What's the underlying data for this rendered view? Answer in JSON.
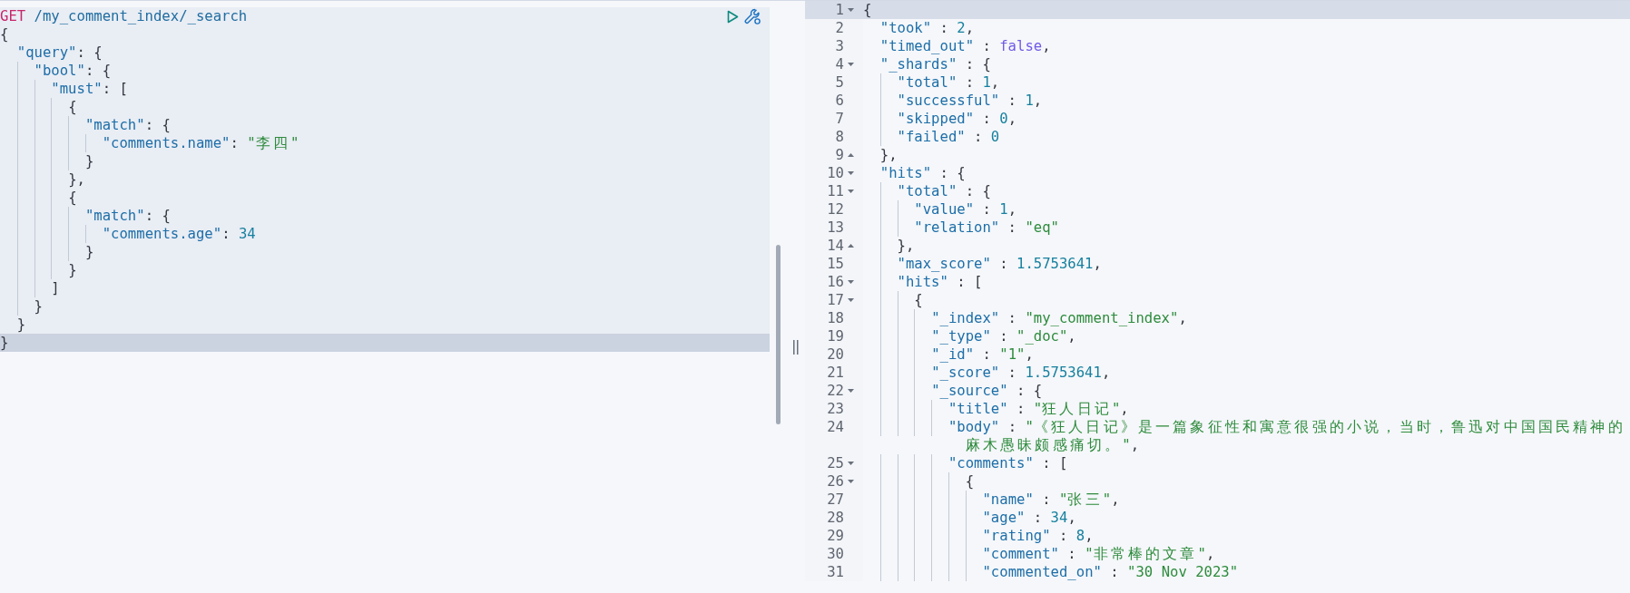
{
  "request_editor": {
    "request": {
      "method": "GET",
      "path": "/my_comment_index/_search"
    },
    "lines": [
      {
        "active": false,
        "tokens": [
          {
            "kind": "punct",
            "text": "{"
          }
        ]
      },
      {
        "active": false,
        "tokens": [
          {
            "kind": "key",
            "text": "  \"query\""
          },
          {
            "kind": "punct",
            "text": ": {"
          }
        ]
      },
      {
        "active": false,
        "tokens": [
          {
            "kind": "key",
            "text": "    \"bool\""
          },
          {
            "kind": "punct",
            "text": ": {"
          }
        ]
      },
      {
        "active": false,
        "tokens": [
          {
            "kind": "key",
            "text": "      \"must\""
          },
          {
            "kind": "punct",
            "text": ": ["
          }
        ]
      },
      {
        "active": false,
        "tokens": [
          {
            "kind": "punct",
            "text": "        {"
          }
        ]
      },
      {
        "active": false,
        "tokens": [
          {
            "kind": "key",
            "text": "          \"match\""
          },
          {
            "kind": "punct",
            "text": ": {"
          }
        ]
      },
      {
        "active": false,
        "tokens": [
          {
            "kind": "key",
            "text": "            \"comments.name\""
          },
          {
            "kind": "punct",
            "text": ": "
          },
          {
            "kind": "string",
            "text": "\"李四\""
          }
        ]
      },
      {
        "active": false,
        "tokens": [
          {
            "kind": "punct",
            "text": "          }"
          }
        ]
      },
      {
        "active": false,
        "tokens": [
          {
            "kind": "punct",
            "text": "        },"
          }
        ]
      },
      {
        "active": false,
        "tokens": [
          {
            "kind": "punct",
            "text": "        {"
          }
        ]
      },
      {
        "active": false,
        "tokens": [
          {
            "kind": "key",
            "text": "          \"match\""
          },
          {
            "kind": "punct",
            "text": ": {"
          }
        ]
      },
      {
        "active": false,
        "tokens": [
          {
            "kind": "key",
            "text": "            \"comments.age\""
          },
          {
            "kind": "punct",
            "text": ": "
          },
          {
            "kind": "number",
            "text": "34"
          }
        ]
      },
      {
        "active": false,
        "tokens": [
          {
            "kind": "punct",
            "text": "          }"
          }
        ]
      },
      {
        "active": false,
        "tokens": [
          {
            "kind": "punct",
            "text": "        }"
          }
        ]
      },
      {
        "active": false,
        "tokens": [
          {
            "kind": "punct",
            "text": "      ]"
          }
        ]
      },
      {
        "active": false,
        "tokens": [
          {
            "kind": "punct",
            "text": "    }"
          }
        ]
      },
      {
        "active": false,
        "tokens": [
          {
            "kind": "punct",
            "text": "  }"
          }
        ]
      },
      {
        "active": true,
        "tokens": [
          {
            "kind": "punct",
            "text": "}"
          }
        ]
      }
    ]
  },
  "response_viewer": {
    "lines": [
      {
        "number": "1",
        "kind": "fold_start",
        "active": true,
        "tokens": [
          {
            "kind": "punct",
            "text": "{"
          }
        ]
      },
      {
        "number": "2",
        "active": false,
        "tokens": [
          {
            "kind": "key",
            "text": "  \"took\""
          },
          {
            "kind": "punct",
            "text": " : "
          },
          {
            "kind": "number",
            "text": "2"
          },
          {
            "kind": "punct",
            "text": ","
          }
        ]
      },
      {
        "number": "3",
        "active": false,
        "tokens": [
          {
            "kind": "key",
            "text": "  \"timed_out\""
          },
          {
            "kind": "punct",
            "text": " : "
          },
          {
            "kind": "boolean",
            "text": "false"
          },
          {
            "kind": "punct",
            "text": ","
          }
        ]
      },
      {
        "number": "4",
        "kind": "fold_start",
        "active": false,
        "tokens": [
          {
            "kind": "key",
            "text": "  \"_shards\""
          },
          {
            "kind": "punct",
            "text": " : {"
          }
        ]
      },
      {
        "number": "5",
        "active": false,
        "tokens": [
          {
            "kind": "key",
            "text": "    \"total\""
          },
          {
            "kind": "punct",
            "text": " : "
          },
          {
            "kind": "number",
            "text": "1"
          },
          {
            "kind": "punct",
            "text": ","
          }
        ]
      },
      {
        "number": "6",
        "active": false,
        "tokens": [
          {
            "kind": "key",
            "text": "    \"successful\""
          },
          {
            "kind": "punct",
            "text": " : "
          },
          {
            "kind": "number",
            "text": "1"
          },
          {
            "kind": "punct",
            "text": ","
          }
        ]
      },
      {
        "number": "7",
        "active": false,
        "tokens": [
          {
            "kind": "key",
            "text": "    \"skipped\""
          },
          {
            "kind": "punct",
            "text": " : "
          },
          {
            "kind": "number",
            "text": "0"
          },
          {
            "kind": "punct",
            "text": ","
          }
        ]
      },
      {
        "number": "8",
        "active": false,
        "tokens": [
          {
            "kind": "key",
            "text": "    \"failed\""
          },
          {
            "kind": "punct",
            "text": " : "
          },
          {
            "kind": "number",
            "text": "0"
          }
        ]
      },
      {
        "number": "9",
        "kind": "fold_end",
        "active": false,
        "tokens": [
          {
            "kind": "punct",
            "text": "  },"
          }
        ]
      },
      {
        "number": "10",
        "kind": "fold_start",
        "active": false,
        "tokens": [
          {
            "kind": "key",
            "text": "  \"hits\""
          },
          {
            "kind": "punct",
            "text": " : {"
          }
        ]
      },
      {
        "number": "11",
        "kind": "fold_start",
        "active": false,
        "tokens": [
          {
            "kind": "key",
            "text": "    \"total\""
          },
          {
            "kind": "punct",
            "text": " : {"
          }
        ]
      },
      {
        "number": "12",
        "active": false,
        "tokens": [
          {
            "kind": "key",
            "text": "      \"value\""
          },
          {
            "kind": "punct",
            "text": " : "
          },
          {
            "kind": "number",
            "text": "1"
          },
          {
            "kind": "punct",
            "text": ","
          }
        ]
      },
      {
        "number": "13",
        "active": false,
        "tokens": [
          {
            "kind": "key",
            "text": "      \"relation\""
          },
          {
            "kind": "punct",
            "text": " : "
          },
          {
            "kind": "string",
            "text": "\"eq\""
          }
        ]
      },
      {
        "number": "14",
        "kind": "fold_end",
        "active": false,
        "tokens": [
          {
            "kind": "punct",
            "text": "    },"
          }
        ]
      },
      {
        "number": "15",
        "active": false,
        "tokens": [
          {
            "kind": "key",
            "text": "    \"max_score\""
          },
          {
            "kind": "punct",
            "text": " : "
          },
          {
            "kind": "number",
            "text": "1.5753641"
          },
          {
            "kind": "punct",
            "text": ","
          }
        ]
      },
      {
        "number": "16",
        "kind": "fold_start",
        "active": false,
        "tokens": [
          {
            "kind": "key",
            "text": "    \"hits\""
          },
          {
            "kind": "punct",
            "text": " : ["
          }
        ]
      },
      {
        "number": "17",
        "kind": "fold_start",
        "active": false,
        "tokens": [
          {
            "kind": "punct",
            "text": "      {"
          }
        ]
      },
      {
        "number": "18",
        "active": false,
        "tokens": [
          {
            "kind": "key",
            "text": "        \"_index\""
          },
          {
            "kind": "punct",
            "text": " : "
          },
          {
            "kind": "string",
            "text": "\"my_comment_index\""
          },
          {
            "kind": "punct",
            "text": ","
          }
        ]
      },
      {
        "number": "19",
        "active": false,
        "tokens": [
          {
            "kind": "key",
            "text": "        \"_type\""
          },
          {
            "kind": "punct",
            "text": " : "
          },
          {
            "kind": "string",
            "text": "\"_doc\""
          },
          {
            "kind": "punct",
            "text": ","
          }
        ]
      },
      {
        "number": "20",
        "active": false,
        "tokens": [
          {
            "kind": "key",
            "text": "        \"_id\""
          },
          {
            "kind": "punct",
            "text": " : "
          },
          {
            "kind": "string",
            "text": "\"1\""
          },
          {
            "kind": "punct",
            "text": ","
          }
        ]
      },
      {
        "number": "21",
        "active": false,
        "tokens": [
          {
            "kind": "key",
            "text": "        \"_score\""
          },
          {
            "kind": "punct",
            "text": " : "
          },
          {
            "kind": "number",
            "text": "1.5753641"
          },
          {
            "kind": "punct",
            "text": ","
          }
        ]
      },
      {
        "number": "22",
        "kind": "fold_start",
        "active": false,
        "tokens": [
          {
            "kind": "key",
            "text": "        \"_source\""
          },
          {
            "kind": "punct",
            "text": " : {"
          }
        ]
      },
      {
        "number": "23",
        "active": false,
        "tokens": [
          {
            "kind": "key",
            "text": "          \"title\""
          },
          {
            "kind": "punct",
            "text": " : "
          },
          {
            "kind": "string",
            "text": "\"狂人日记\""
          },
          {
            "kind": "punct",
            "text": ","
          }
        ]
      },
      {
        "number": "24",
        "active": false,
        "tokens": [
          {
            "kind": "key",
            "text": "          \"body\""
          },
          {
            "kind": "punct",
            "text": " : "
          },
          {
            "kind": "string",
            "text": "\"《狂人日记》是一篇象征性和寓意很强的小说，当时，鲁迅对中国国民精神的麻木愚昧颇感痛切。\""
          },
          {
            "kind": "punct",
            "text": ","
          }
        ]
      },
      {
        "number": "25",
        "kind": "fold_start",
        "active": false,
        "tokens": [
          {
            "kind": "key",
            "text": "          \"comments\""
          },
          {
            "kind": "punct",
            "text": " : ["
          }
        ]
      },
      {
        "number": "26",
        "kind": "fold_start",
        "active": false,
        "tokens": [
          {
            "kind": "punct",
            "text": "            {"
          }
        ]
      },
      {
        "number": "27",
        "active": false,
        "tokens": [
          {
            "kind": "key",
            "text": "              \"name\""
          },
          {
            "kind": "punct",
            "text": " : "
          },
          {
            "kind": "string",
            "text": "\"张三\""
          },
          {
            "kind": "punct",
            "text": ","
          }
        ]
      },
      {
        "number": "28",
        "active": false,
        "tokens": [
          {
            "kind": "key",
            "text": "              \"age\""
          },
          {
            "kind": "punct",
            "text": " : "
          },
          {
            "kind": "number",
            "text": "34"
          },
          {
            "kind": "punct",
            "text": ","
          }
        ]
      },
      {
        "number": "29",
        "active": false,
        "tokens": [
          {
            "kind": "key",
            "text": "              \"rating\""
          },
          {
            "kind": "punct",
            "text": " : "
          },
          {
            "kind": "number",
            "text": "8"
          },
          {
            "kind": "punct",
            "text": ","
          }
        ]
      },
      {
        "number": "30",
        "active": false,
        "tokens": [
          {
            "kind": "key",
            "text": "              \"comment\""
          },
          {
            "kind": "punct",
            "text": " : "
          },
          {
            "kind": "string",
            "text": "\"非常棒的文章\""
          },
          {
            "kind": "punct",
            "text": ","
          }
        ]
      },
      {
        "number": "31",
        "active": false,
        "tokens": [
          {
            "kind": "key",
            "text": "              \"commented_on\""
          },
          {
            "kind": "punct",
            "text": " : "
          },
          {
            "kind": "string",
            "text": "\"30 Nov 2023\""
          }
        ]
      }
    ]
  }
}
